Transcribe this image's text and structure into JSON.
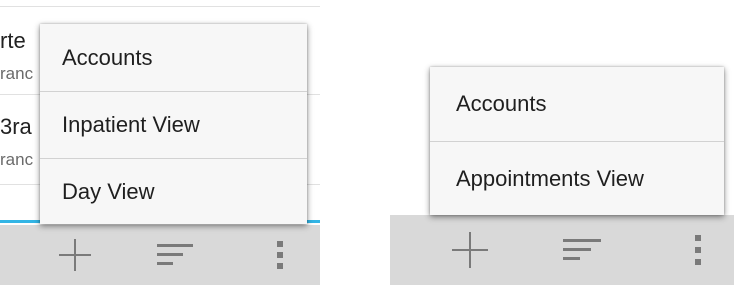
{
  "left_screen": {
    "background_list": [
      {
        "title": "rte",
        "subtitle": "ranc"
      },
      {
        "title": "3ra",
        "subtitle": "ranc"
      }
    ],
    "menu": {
      "items": [
        {
          "label": "Accounts"
        },
        {
          "label": "Inpatient View"
        },
        {
          "label": "Day View"
        }
      ]
    },
    "action_bar": {
      "icons": [
        "add-icon",
        "sort-icon",
        "overflow-menu-icon"
      ]
    }
  },
  "right_screen": {
    "menu": {
      "items": [
        {
          "label": "Accounts"
        },
        {
          "label": "Appointments View"
        }
      ]
    },
    "action_bar": {
      "icons": [
        "add-icon",
        "sort-icon",
        "overflow-menu-icon"
      ]
    }
  },
  "colors": {
    "accent": "#33b5e5",
    "action_bar": "#d9d9d9",
    "menu_background": "#f7f7f7"
  }
}
